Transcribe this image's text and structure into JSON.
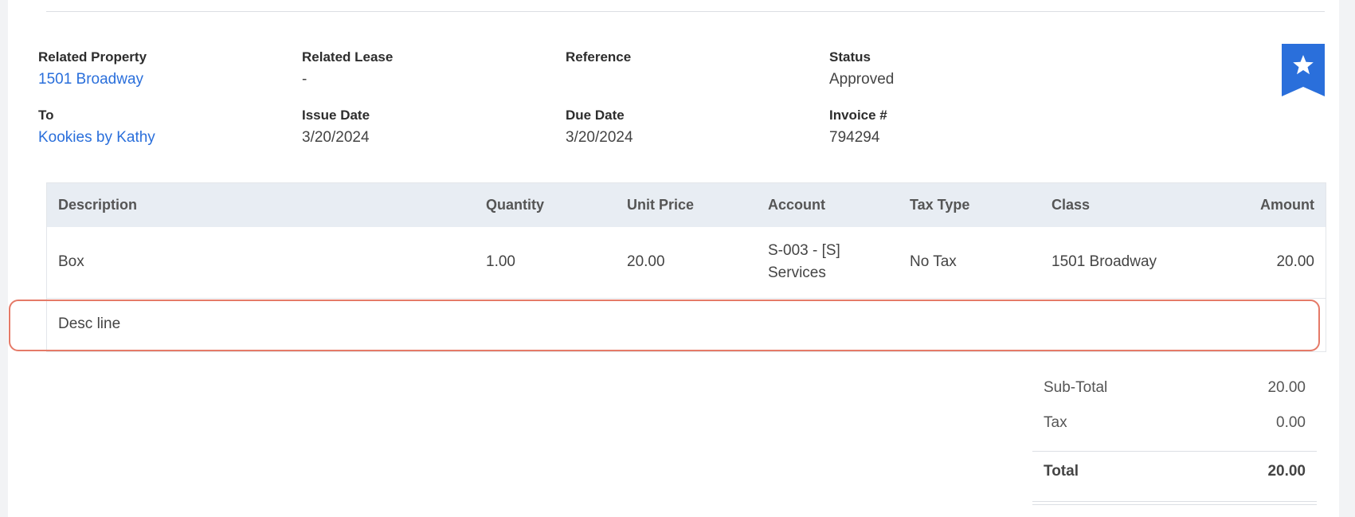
{
  "colors": {
    "accent": "#2a6fdb",
    "highlight": "#e57a68",
    "header_bg": "#e8edf3"
  },
  "details": {
    "related_property": {
      "label": "Related Property",
      "value": "1501 Broadway"
    },
    "related_lease": {
      "label": "Related Lease",
      "value": "-"
    },
    "reference": {
      "label": "Reference",
      "value": ""
    },
    "status": {
      "label": "Status",
      "value": "Approved"
    },
    "to": {
      "label": "To",
      "value": "Kookies by Kathy"
    },
    "issue_date": {
      "label": "Issue Date",
      "value": "3/20/2024"
    },
    "due_date": {
      "label": "Due Date",
      "value": "3/20/2024"
    },
    "invoice_no": {
      "label": "Invoice #",
      "value": "794294"
    }
  },
  "bookmark": {
    "icon": "star-icon"
  },
  "table": {
    "headers": {
      "description": "Description",
      "quantity": "Quantity",
      "unit_price": "Unit Price",
      "account": "Account",
      "tax_type": "Tax Type",
      "class": "Class",
      "amount": "Amount"
    },
    "rows": [
      {
        "description": "Box",
        "quantity": "1.00",
        "unit_price": "20.00",
        "account_line1": "S-003 - [S]",
        "account_line2": "Services",
        "tax_type": "No Tax",
        "class": "1501 Broadway",
        "amount": "20.00"
      }
    ],
    "desc_line": "Desc line"
  },
  "totals": {
    "subtotal_label": "Sub-Total",
    "subtotal": "20.00",
    "tax_label": "Tax",
    "tax": "0.00",
    "total_label": "Total",
    "total": "20.00"
  }
}
